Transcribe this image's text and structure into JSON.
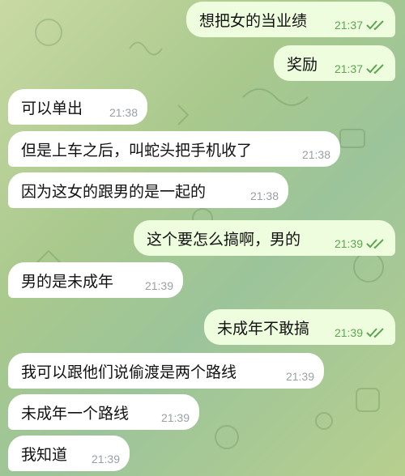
{
  "colors": {
    "incoming_bubble": "#ffffff",
    "outgoing_bubble": "#eefdde",
    "timestamp_incoming": "#9aa0a6",
    "timestamp_outgoing": "#5fa453",
    "wallpaper": "#a9c98d"
  },
  "messages": [
    {
      "text": "想把女的当业绩",
      "time": "21:37",
      "direction": "outgoing",
      "status": "read"
    },
    {
      "text": "奖励",
      "time": "21:37",
      "direction": "outgoing",
      "status": "read"
    },
    {
      "text": "可以单出",
      "time": "21:38",
      "direction": "incoming"
    },
    {
      "text": "但是上车之后，叫蛇头把手机收了",
      "time": "21:38",
      "direction": "incoming"
    },
    {
      "text": "因为这女的跟男的是一起的",
      "time": "21:38",
      "direction": "incoming"
    },
    {
      "text": "这个要怎么搞啊，男的",
      "time": "21:39",
      "direction": "outgoing",
      "status": "read"
    },
    {
      "text": "男的是未成年",
      "time": "21:39",
      "direction": "incoming"
    },
    {
      "text": "未成年不敢搞",
      "time": "21:39",
      "direction": "outgoing",
      "status": "read"
    },
    {
      "text": "我可以跟他们说偷渡是两个路线",
      "time": "21:39",
      "direction": "incoming"
    },
    {
      "text": "未成年一个路线",
      "time": "21:39",
      "direction": "incoming"
    },
    {
      "text": "我知道",
      "time": "21:39",
      "direction": "incoming"
    }
  ]
}
